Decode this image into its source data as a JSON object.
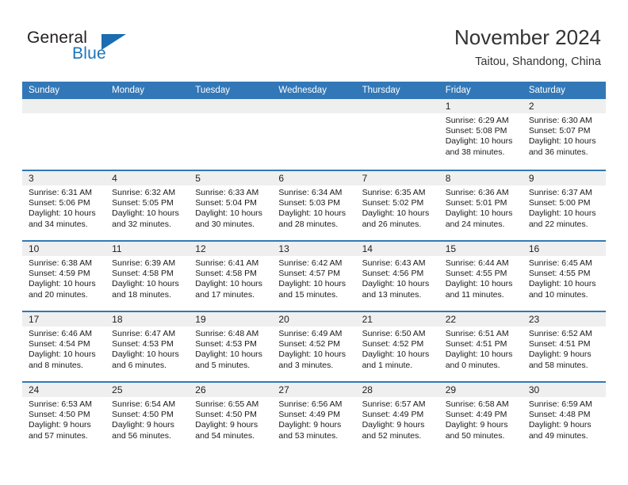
{
  "brand": {
    "name_part1": "General",
    "name_part2": "Blue",
    "accent_color": "#1b75bb",
    "triangle_color": "#1b6cb0"
  },
  "header": {
    "month_title": "November 2024",
    "location": "Taitou, Shandong, China"
  },
  "calendar": {
    "header_color": "#3278b8",
    "weekdays": [
      "Sunday",
      "Monday",
      "Tuesday",
      "Wednesday",
      "Thursday",
      "Friday",
      "Saturday"
    ],
    "weeks": [
      [
        {
          "date": "",
          "sunrise": "",
          "sunset": "",
          "daylight": "",
          "empty": true
        },
        {
          "date": "",
          "sunrise": "",
          "sunset": "",
          "daylight": "",
          "empty": true
        },
        {
          "date": "",
          "sunrise": "",
          "sunset": "",
          "daylight": "",
          "empty": true
        },
        {
          "date": "",
          "sunrise": "",
          "sunset": "",
          "daylight": "",
          "empty": true
        },
        {
          "date": "",
          "sunrise": "",
          "sunset": "",
          "daylight": "",
          "empty": true
        },
        {
          "date": "1",
          "sunrise": "Sunrise: 6:29 AM",
          "sunset": "Sunset: 5:08 PM",
          "daylight": "Daylight: 10 hours and 38 minutes."
        },
        {
          "date": "2",
          "sunrise": "Sunrise: 6:30 AM",
          "sunset": "Sunset: 5:07 PM",
          "daylight": "Daylight: 10 hours and 36 minutes."
        }
      ],
      [
        {
          "date": "3",
          "sunrise": "Sunrise: 6:31 AM",
          "sunset": "Sunset: 5:06 PM",
          "daylight": "Daylight: 10 hours and 34 minutes."
        },
        {
          "date": "4",
          "sunrise": "Sunrise: 6:32 AM",
          "sunset": "Sunset: 5:05 PM",
          "daylight": "Daylight: 10 hours and 32 minutes."
        },
        {
          "date": "5",
          "sunrise": "Sunrise: 6:33 AM",
          "sunset": "Sunset: 5:04 PM",
          "daylight": "Daylight: 10 hours and 30 minutes."
        },
        {
          "date": "6",
          "sunrise": "Sunrise: 6:34 AM",
          "sunset": "Sunset: 5:03 PM",
          "daylight": "Daylight: 10 hours and 28 minutes."
        },
        {
          "date": "7",
          "sunrise": "Sunrise: 6:35 AM",
          "sunset": "Sunset: 5:02 PM",
          "daylight": "Daylight: 10 hours and 26 minutes."
        },
        {
          "date": "8",
          "sunrise": "Sunrise: 6:36 AM",
          "sunset": "Sunset: 5:01 PM",
          "daylight": "Daylight: 10 hours and 24 minutes."
        },
        {
          "date": "9",
          "sunrise": "Sunrise: 6:37 AM",
          "sunset": "Sunset: 5:00 PM",
          "daylight": "Daylight: 10 hours and 22 minutes."
        }
      ],
      [
        {
          "date": "10",
          "sunrise": "Sunrise: 6:38 AM",
          "sunset": "Sunset: 4:59 PM",
          "daylight": "Daylight: 10 hours and 20 minutes."
        },
        {
          "date": "11",
          "sunrise": "Sunrise: 6:39 AM",
          "sunset": "Sunset: 4:58 PM",
          "daylight": "Daylight: 10 hours and 18 minutes."
        },
        {
          "date": "12",
          "sunrise": "Sunrise: 6:41 AM",
          "sunset": "Sunset: 4:58 PM",
          "daylight": "Daylight: 10 hours and 17 minutes."
        },
        {
          "date": "13",
          "sunrise": "Sunrise: 6:42 AM",
          "sunset": "Sunset: 4:57 PM",
          "daylight": "Daylight: 10 hours and 15 minutes."
        },
        {
          "date": "14",
          "sunrise": "Sunrise: 6:43 AM",
          "sunset": "Sunset: 4:56 PM",
          "daylight": "Daylight: 10 hours and 13 minutes."
        },
        {
          "date": "15",
          "sunrise": "Sunrise: 6:44 AM",
          "sunset": "Sunset: 4:55 PM",
          "daylight": "Daylight: 10 hours and 11 minutes."
        },
        {
          "date": "16",
          "sunrise": "Sunrise: 6:45 AM",
          "sunset": "Sunset: 4:55 PM",
          "daylight": "Daylight: 10 hours and 10 minutes."
        }
      ],
      [
        {
          "date": "17",
          "sunrise": "Sunrise: 6:46 AM",
          "sunset": "Sunset: 4:54 PM",
          "daylight": "Daylight: 10 hours and 8 minutes."
        },
        {
          "date": "18",
          "sunrise": "Sunrise: 6:47 AM",
          "sunset": "Sunset: 4:53 PM",
          "daylight": "Daylight: 10 hours and 6 minutes."
        },
        {
          "date": "19",
          "sunrise": "Sunrise: 6:48 AM",
          "sunset": "Sunset: 4:53 PM",
          "daylight": "Daylight: 10 hours and 5 minutes."
        },
        {
          "date": "20",
          "sunrise": "Sunrise: 6:49 AM",
          "sunset": "Sunset: 4:52 PM",
          "daylight": "Daylight: 10 hours and 3 minutes."
        },
        {
          "date": "21",
          "sunrise": "Sunrise: 6:50 AM",
          "sunset": "Sunset: 4:52 PM",
          "daylight": "Daylight: 10 hours and 1 minute."
        },
        {
          "date": "22",
          "sunrise": "Sunrise: 6:51 AM",
          "sunset": "Sunset: 4:51 PM",
          "daylight": "Daylight: 10 hours and 0 minutes."
        },
        {
          "date": "23",
          "sunrise": "Sunrise: 6:52 AM",
          "sunset": "Sunset: 4:51 PM",
          "daylight": "Daylight: 9 hours and 58 minutes."
        }
      ],
      [
        {
          "date": "24",
          "sunrise": "Sunrise: 6:53 AM",
          "sunset": "Sunset: 4:50 PM",
          "daylight": "Daylight: 9 hours and 57 minutes."
        },
        {
          "date": "25",
          "sunrise": "Sunrise: 6:54 AM",
          "sunset": "Sunset: 4:50 PM",
          "daylight": "Daylight: 9 hours and 56 minutes."
        },
        {
          "date": "26",
          "sunrise": "Sunrise: 6:55 AM",
          "sunset": "Sunset: 4:50 PM",
          "daylight": "Daylight: 9 hours and 54 minutes."
        },
        {
          "date": "27",
          "sunrise": "Sunrise: 6:56 AM",
          "sunset": "Sunset: 4:49 PM",
          "daylight": "Daylight: 9 hours and 53 minutes."
        },
        {
          "date": "28",
          "sunrise": "Sunrise: 6:57 AM",
          "sunset": "Sunset: 4:49 PM",
          "daylight": "Daylight: 9 hours and 52 minutes."
        },
        {
          "date": "29",
          "sunrise": "Sunrise: 6:58 AM",
          "sunset": "Sunset: 4:49 PM",
          "daylight": "Daylight: 9 hours and 50 minutes."
        },
        {
          "date": "30",
          "sunrise": "Sunrise: 6:59 AM",
          "sunset": "Sunset: 4:48 PM",
          "daylight": "Daylight: 9 hours and 49 minutes."
        }
      ]
    ]
  }
}
